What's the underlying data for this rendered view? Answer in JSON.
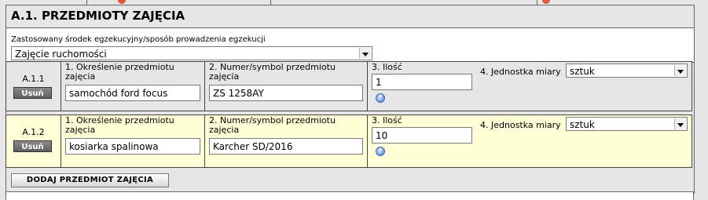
{
  "section": {
    "title": "A.1. PRZEDMIOTY ZAJĘCIA",
    "method_label": "Zastosowany środek egzekucyjny/sposób prowadzenia egzekucji",
    "method_value": "Zajęcie ruchomości"
  },
  "columns": {
    "name": "1. Określenie przedmiotu zajęcia",
    "name_line1": "1. Określenie przedmiotu",
    "name_line2": "zajęcia",
    "symbol_line1": "2. Numer/symbol przedmiotu",
    "symbol_line2": "zajęcia",
    "qty": "3. Ilość",
    "unit": "4. Jednostka miary"
  },
  "items": [
    {
      "number": "A.1.1",
      "delete_label": "Usuń",
      "name": "samochód ford focus",
      "symbol": "ZS 1258AY",
      "quantity": "1",
      "unit": "sztuk"
    },
    {
      "number": "A.1.2",
      "delete_label": "Usuń",
      "name": "kosiarka spalinowa",
      "symbol": "Karcher SD/2016",
      "quantity": "10",
      "unit": "sztuk"
    }
  ],
  "add_button_label": "DODAJ PRZEDMIOT ZAJĘCIA",
  "help_icon_glyph": "?",
  "colors": {
    "row_highlight": "#ffffd8",
    "panel_bg": "#e6e6e6",
    "delete_button": "#6f6f6f"
  }
}
